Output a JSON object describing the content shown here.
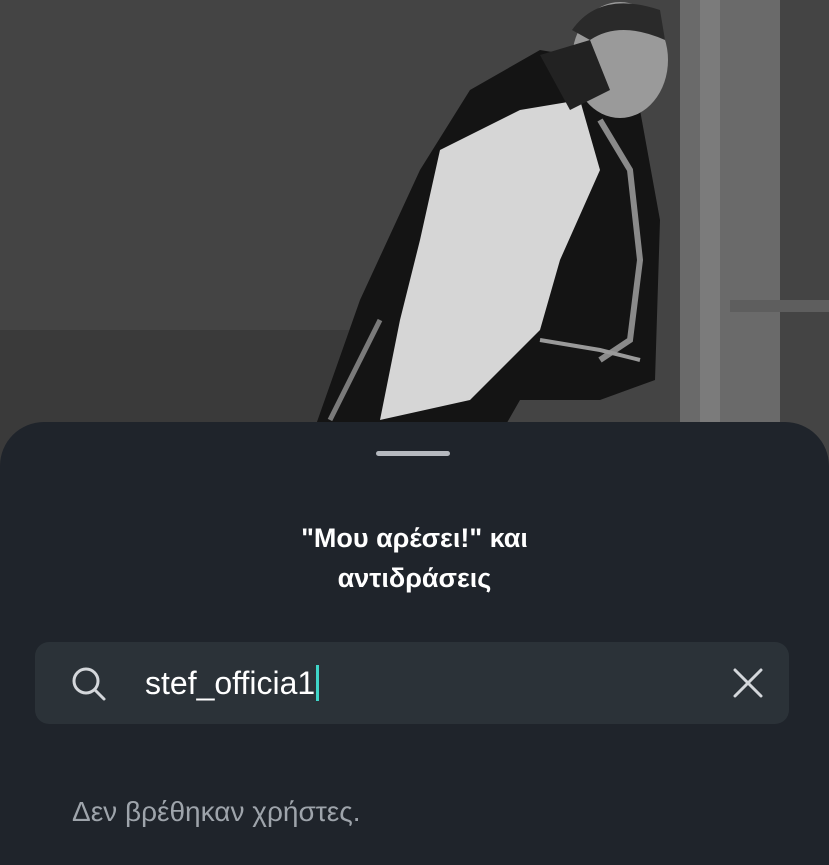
{
  "background_photo": {
    "description_icon": "photo-background"
  },
  "sheet": {
    "title": "\"Μου αρέσει!\" και\nαντιδράσεις"
  },
  "search": {
    "value": "stef_officia1",
    "search_icon": "search-icon",
    "clear_icon": "close-icon"
  },
  "results": {
    "empty_message": "Δεν βρέθηκαν χρήστες."
  },
  "colors": {
    "sheet_bg": "#1f242b",
    "search_bg": "#2b3238",
    "caret": "#3fd6c9",
    "empty_text": "#9ea4ab"
  }
}
